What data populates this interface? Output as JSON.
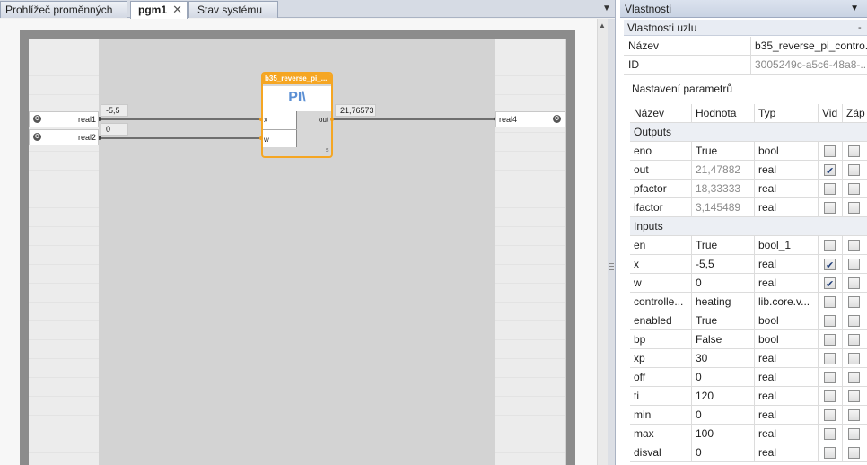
{
  "tabs": {
    "tab1": "Prohlížeč proměnných",
    "tab2": "pgm1",
    "tab2_close": "✕",
    "tab3": "Stav systému",
    "menu": "▼"
  },
  "diagram": {
    "block_title": "b35_reverse_pi_...",
    "block_symbol": "PI\\",
    "port_x": "x",
    "port_w": "w",
    "port_out": "out",
    "block_footer": "s",
    "var_in1": "real1",
    "var_in2": "real2",
    "var_out": "real4",
    "val_in1": "-5,5",
    "val_in2": "0",
    "val_out": "21,76573",
    "var_icon": "⚙"
  },
  "properties": {
    "panel_title": "Vlastnosti",
    "panel_arrow": "▼",
    "section": "Vlastnosti uzlu",
    "section_pin": "-",
    "name_label": "Název",
    "name_value": "b35_reverse_pi_contro...",
    "id_label": "ID",
    "id_value": "3005249c-a5c6-48a8-...",
    "params_title": "Nastavení parametrů",
    "columns": {
      "name": "Název",
      "value": "Hodnota",
      "type": "Typ",
      "vid": "Vid",
      "zap": "Záp"
    },
    "group_outputs": "Outputs",
    "group_inputs": "Inputs",
    "outputs": [
      {
        "name": "eno",
        "value": "True",
        "type": "bool",
        "vid": false,
        "zap": false
      },
      {
        "name": "out",
        "value": "21,47882",
        "type": "real",
        "vid": true,
        "zap": false
      },
      {
        "name": "pfactor",
        "value": "18,33333",
        "type": "real",
        "vid": false,
        "zap": false
      },
      {
        "name": "ifactor",
        "value": "3,145489",
        "type": "real",
        "vid": false,
        "zap": false
      }
    ],
    "inputs": [
      {
        "name": "en",
        "value": "True",
        "type": "bool_1",
        "vid": false,
        "zap": false
      },
      {
        "name": "x",
        "value": "-5,5",
        "type": "real",
        "vid": true,
        "zap": false
      },
      {
        "name": "w",
        "value": "0",
        "type": "real",
        "vid": true,
        "zap": false
      },
      {
        "name": "controlle...",
        "value": "heating",
        "type": "lib.core.v...",
        "vid": false,
        "zap": false
      },
      {
        "name": "enabled",
        "value": "True",
        "type": "bool",
        "vid": false,
        "zap": false
      },
      {
        "name": "bp",
        "value": "False",
        "type": "bool",
        "vid": false,
        "zap": false
      },
      {
        "name": "xp",
        "value": "30",
        "type": "real",
        "vid": false,
        "zap": false
      },
      {
        "name": "off",
        "value": "0",
        "type": "real",
        "vid": false,
        "zap": false
      },
      {
        "name": "ti",
        "value": "120",
        "type": "real",
        "vid": false,
        "zap": false
      },
      {
        "name": "min",
        "value": "0",
        "type": "real",
        "vid": false,
        "zap": false
      },
      {
        "name": "max",
        "value": "100",
        "type": "real",
        "vid": false,
        "zap": false
      },
      {
        "name": "disval",
        "value": "0",
        "type": "real",
        "vid": false,
        "zap": false
      }
    ]
  }
}
